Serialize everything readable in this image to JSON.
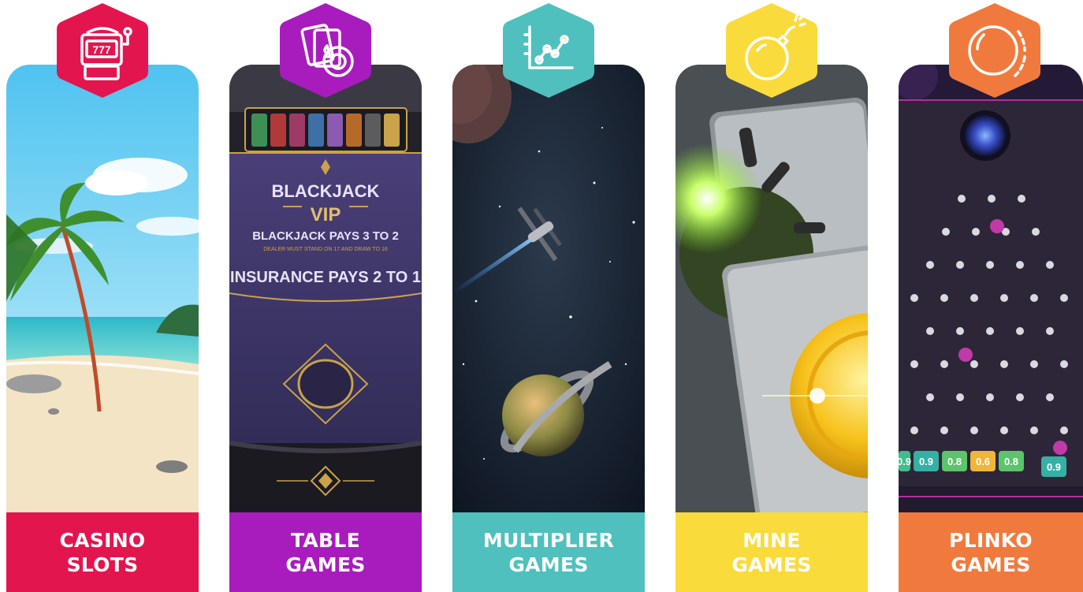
{
  "colors": {
    "slots": "#e3154f",
    "table": "#a81cbd",
    "multiplier": "#4fc0bd",
    "mine": "#fadb3c",
    "plinko": "#f07a3e"
  },
  "cards": [
    {
      "line1": "CASINO",
      "line2": "SLOTS",
      "icon": "slot-machine-icon"
    },
    {
      "line1": "TABLE",
      "line2": "GAMES",
      "icon": "cards-chip-icon"
    },
    {
      "line1": "MULTIPLIER",
      "line2": "GAMES",
      "icon": "line-graph-icon"
    },
    {
      "line1": "MINE",
      "line2": "GAMES",
      "icon": "bomb-icon"
    },
    {
      "line1": "PLINKO",
      "line2": "GAMES",
      "icon": "ball-icon"
    }
  ],
  "slots_art": {
    "reel_text": "777"
  },
  "table_art": {
    "title": "BLACKJACK",
    "vip": "VIP",
    "line1": "BLACKJACK PAYS 3 TO 2",
    "line2": "DEALER MUST STAND ON 17 AND DRAW TO 16",
    "line3": "INSURANCE PAYS 2 TO 1"
  },
  "plinko_art": {
    "multipliers": [
      "0.9",
      "0.9",
      "0.8",
      "0.6",
      "0.8",
      "0.9"
    ]
  }
}
